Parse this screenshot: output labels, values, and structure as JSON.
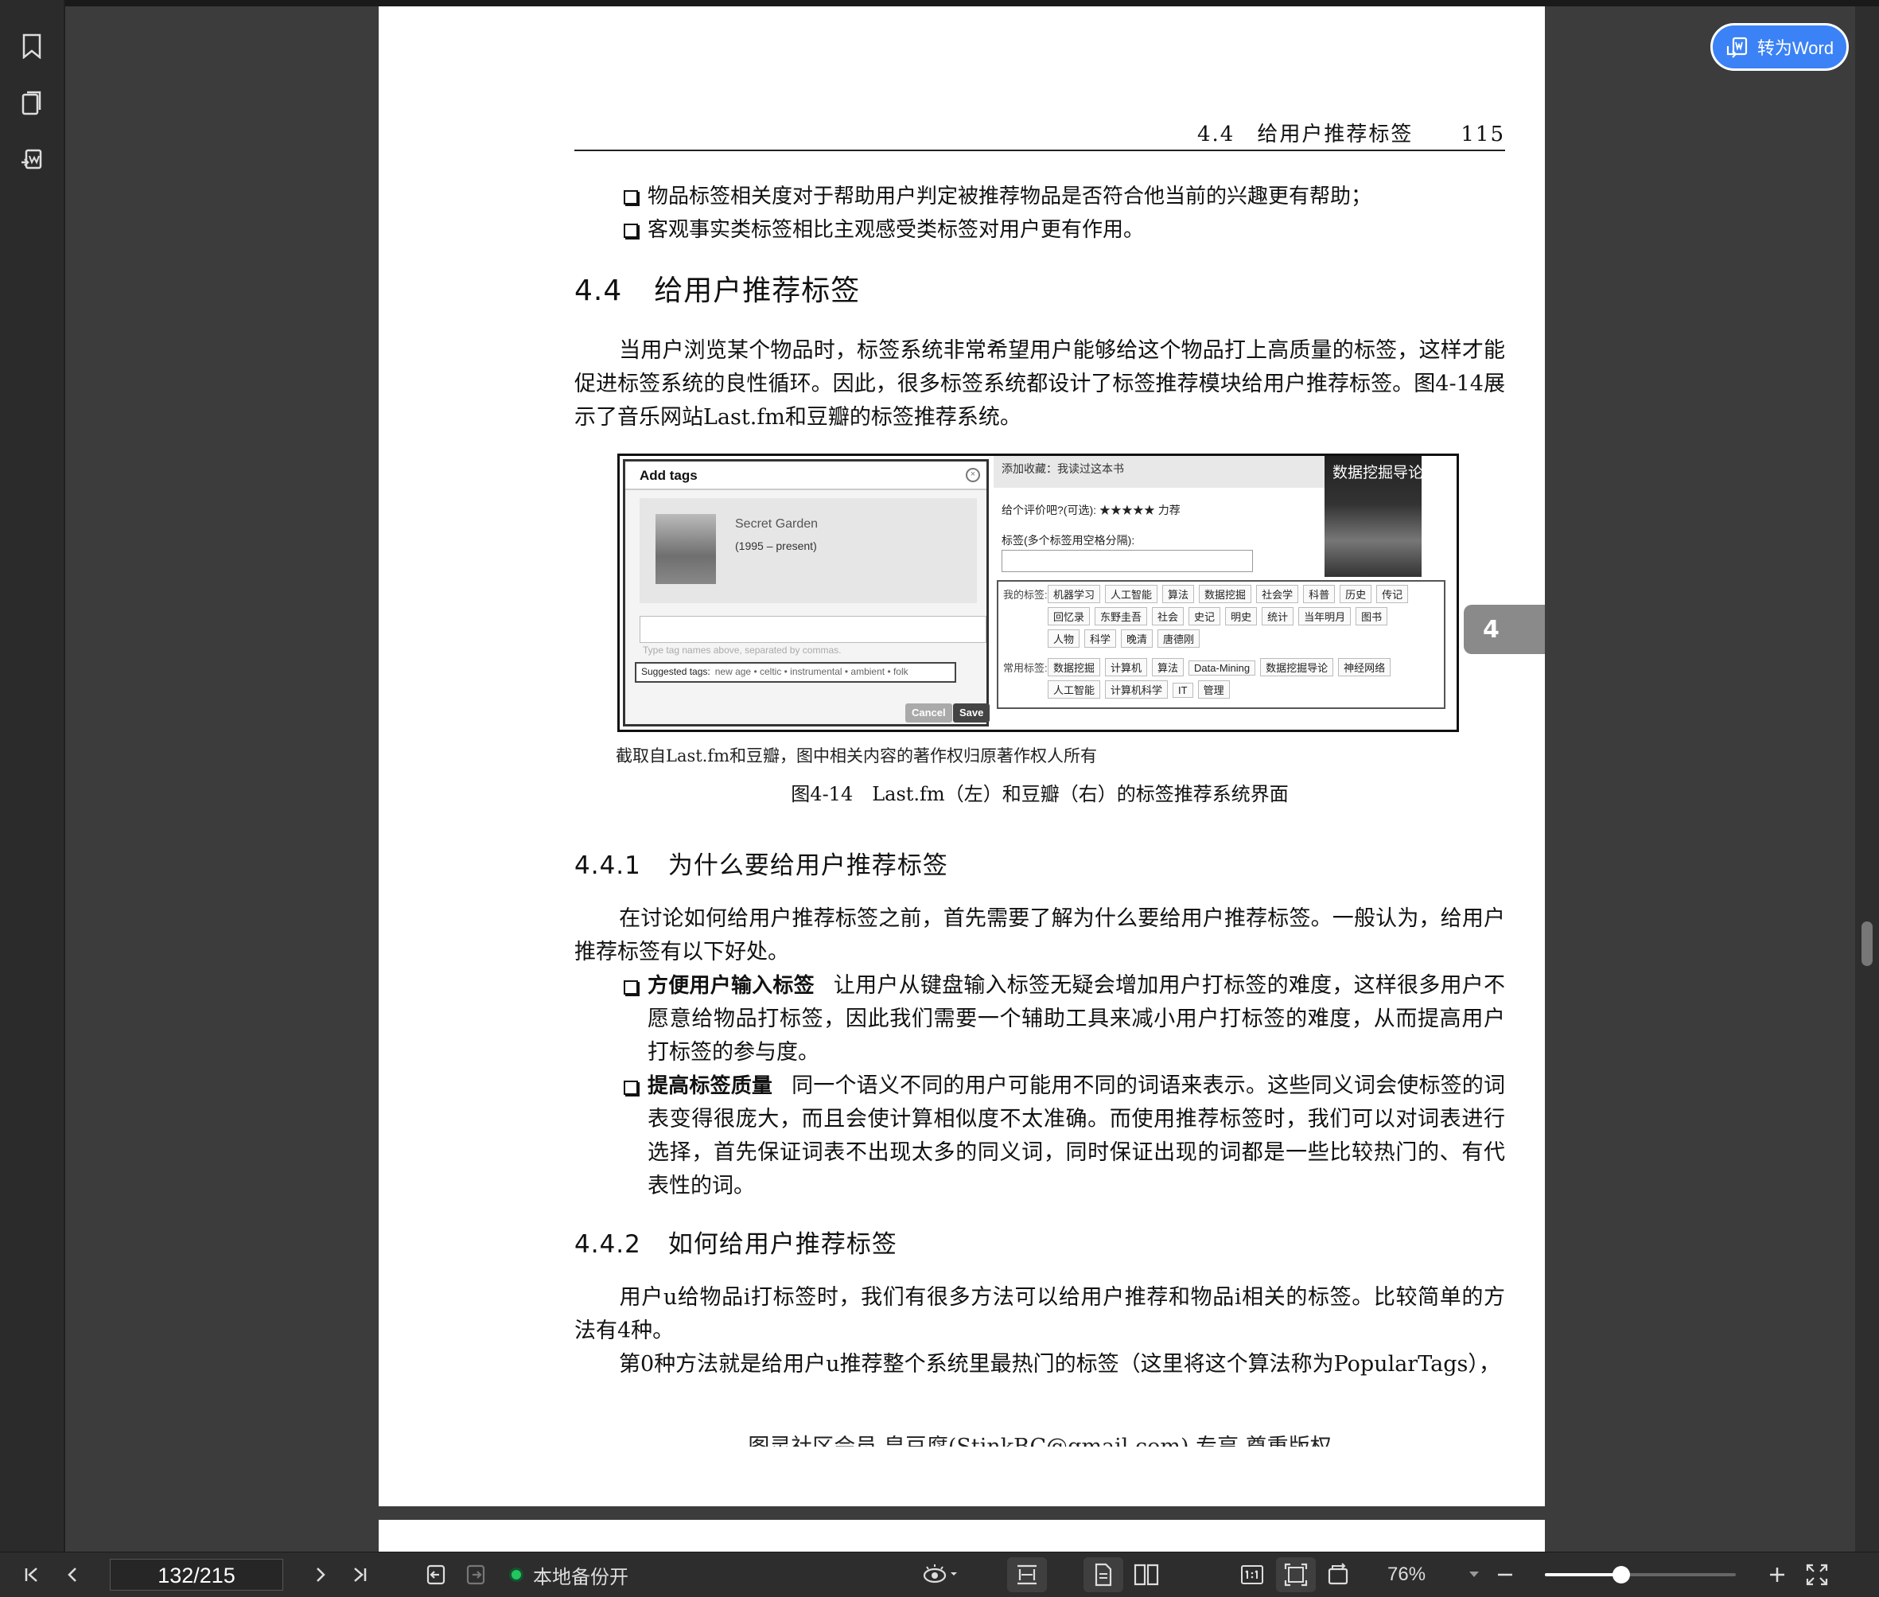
{
  "app": {
    "convert_button": "转为Word",
    "side_tab": "4"
  },
  "page": {
    "running_head": {
      "section": "4.4　给用户推荐标签",
      "page_number": "115"
    },
    "top_bullets": [
      "物品标签相关度对于帮助用户判定被推荐物品是否符合他当前的兴趣更有帮助；",
      "客观事实类标签相比主观感受类标签对用户更有作用。"
    ],
    "h_44": {
      "num": "4.4",
      "title": "给用户推荐标签"
    },
    "para_44": "当用户浏览某个物品时，标签系统非常希望用户能够给这个物品打上高质量的标签，这样才能促进标签系统的良性循环。因此，很多标签系统都设计了标签推荐模块给用户推荐标签。图4-14展示了音乐网站Last.fm和豆瓣的标签推荐系统。",
    "figure": {
      "lastfm": {
        "header": "Add tags",
        "close": "×",
        "artist": "Secret Garden",
        "years": "(1995 – present)",
        "input_hint": "Type tag names above, separated by commas.",
        "suggested_label": "Suggested tags:",
        "suggested_tags": "new age • celtic • instrumental • ambient • folk",
        "cancel": "Cancel",
        "save": "Save"
      },
      "douban": {
        "top": "添加收藏：我读过这本书",
        "rating": "给个评价吧?(可选): ★★★★★ 力荐",
        "tag_label": "标签(多个标签用空格分隔):",
        "cover_title": "数据挖掘导论",
        "my_tags_label": "我的标签:",
        "my_tags_row1": [
          "机器学习",
          "人工智能",
          "算法",
          "数据挖掘",
          "社会学",
          "科普",
          "历史",
          "传记"
        ],
        "my_tags_row2": [
          "回忆录",
          "东野圭吾",
          "社会",
          "史记",
          "明史",
          "统计",
          "当年明月",
          "图书"
        ],
        "my_tags_row3": [
          "人物",
          "科学",
          "晚清",
          "唐德刚"
        ],
        "common_tags_label": "常用标签:",
        "common_tags_row1": [
          "数据挖掘",
          "计算机",
          "算法",
          "Data-Mining",
          "数据挖掘导论",
          "神经网络"
        ],
        "common_tags_row2": [
          "人工智能",
          "计算机科学",
          "IT",
          "管理"
        ]
      }
    },
    "caption_credit": "截取自Last.fm和豆瓣，图中相关内容的著作权归原著作权人所有",
    "caption_fig": "图4-14　Last.fm（左）和豆瓣（右）的标签推荐系统界面",
    "h_441": {
      "num": "4.4.1",
      "title": "为什么要给用户推荐标签"
    },
    "para_441": "在讨论如何给用户推荐标签之前，首先需要了解为什么要给用户推荐标签。一般认为，给用户推荐标签有以下好处。",
    "bullets_441": [
      {
        "term": "方便用户输入标签",
        "text": "让用户从键盘输入标签无疑会增加用户打标签的难度，这样很多用户不愿意给物品打标签，因此我们需要一个辅助工具来减小用户打标签的难度，从而提高用户打标签的参与度。"
      },
      {
        "term": "提高标签质量",
        "text": "同一个语义不同的用户可能用不同的词语来表示。这些同义词会使标签的词表变得很庞大，而且会使计算相似度不太准确。而使用推荐标签时，我们可以对词表进行选择，首先保证词表不出现太多的同义词，同时保证出现的词都是一些比较热门的、有代表性的词。"
      }
    ],
    "h_442": {
      "num": "4.4.2",
      "title": "如何给用户推荐标签"
    },
    "para_442a": "用户u给物品i打标签时，我们有很多方法可以给用户推荐和物品i相关的标签。比较简单的方法有4种。",
    "para_442b": "第0种方法就是给用户u推荐整个系统里最热门的标签（这里将这个算法称为PopularTags），",
    "footer_cut": "图灵社区会员 皇豆腐(StinkBC@gmail.com) 专享 尊重版权"
  },
  "statusbar": {
    "page_indicator": "132/215",
    "backup_label": "本地备份开",
    "zoom": "76%",
    "zoom_level": 0.4
  }
}
